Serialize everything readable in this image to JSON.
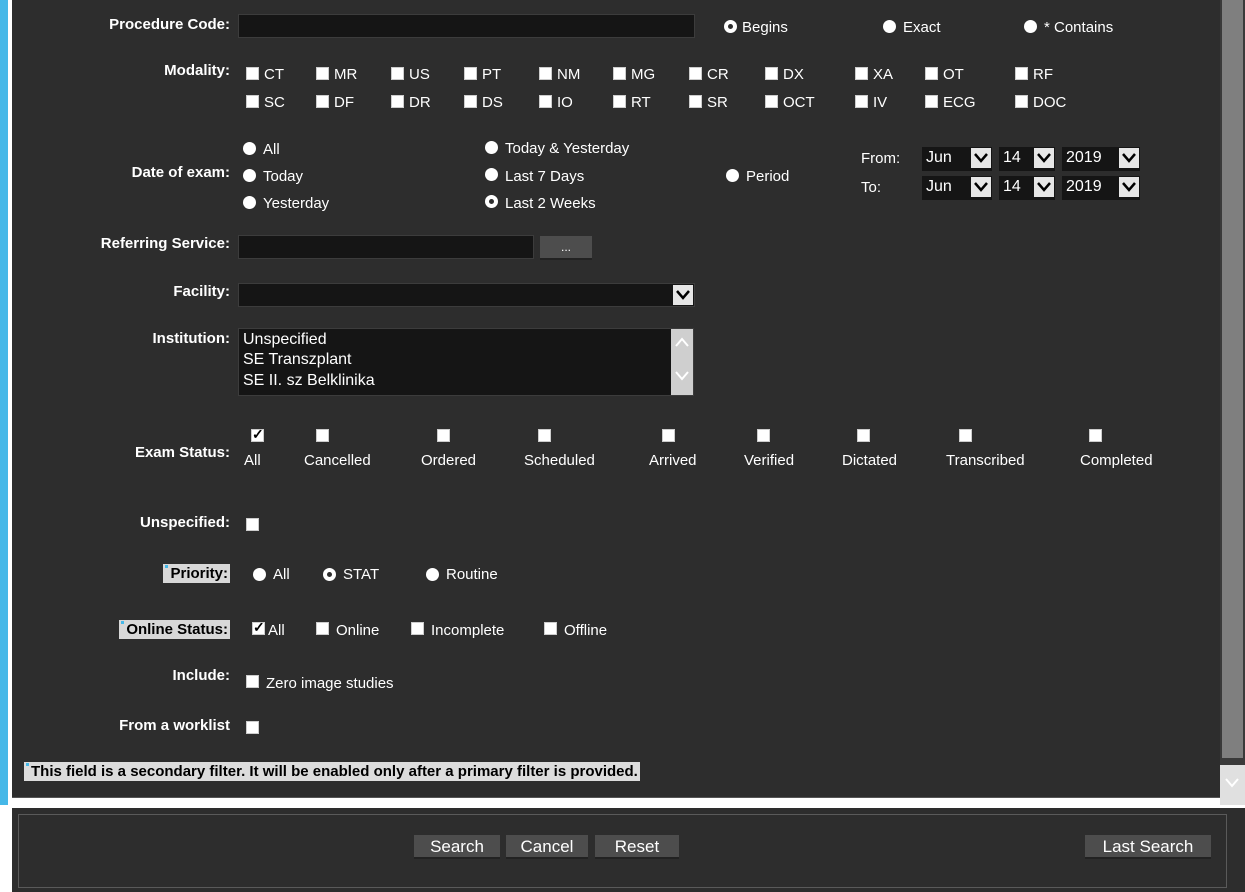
{
  "procedure_code": {
    "label": "Procedure Code:",
    "value": "",
    "match_options": [
      {
        "label": "Begins",
        "selected": true
      },
      {
        "label": "Exact",
        "selected": false
      },
      {
        "label": "* Contains",
        "selected": false
      }
    ]
  },
  "modality": {
    "label": "Modality:",
    "row1": [
      "CT",
      "MR",
      "US",
      "PT",
      "NM",
      "MG",
      "CR",
      "DX",
      "XA",
      "OT",
      "RF"
    ],
    "row2": [
      "SC",
      "DF",
      "DR",
      "DS",
      "IO",
      "RT",
      "SR",
      "OCT",
      "IV",
      "ECG",
      "DOC"
    ]
  },
  "date_of_exam": {
    "label": "Date of exam:",
    "options": [
      {
        "label": "All",
        "selected": false
      },
      {
        "label": "Today",
        "selected": false
      },
      {
        "label": "Yesterday",
        "selected": false
      },
      {
        "label": "Today & Yesterday",
        "selected": false
      },
      {
        "label": "Last 7 Days",
        "selected": false
      },
      {
        "label": "Last 2 Weeks",
        "selected": true
      },
      {
        "label": "Period",
        "selected": false
      }
    ],
    "from_label": "From:",
    "to_label": "To:",
    "from": {
      "month": "Jun",
      "day": "14",
      "year": "2019"
    },
    "to": {
      "month": "Jun",
      "day": "14",
      "year": "2019"
    }
  },
  "referring_service": {
    "label": "Referring Service:",
    "value": "",
    "browse_label": "..."
  },
  "facility": {
    "label": "Facility:",
    "value": ""
  },
  "institution": {
    "label": "Institution:",
    "items": [
      "Unspecified",
      "SE Transzplant",
      "SE II. sz Belklinika"
    ]
  },
  "exam_status": {
    "label": "Exam Status:",
    "options": [
      {
        "label": "All",
        "checked": true
      },
      {
        "label": "Cancelled",
        "checked": false
      },
      {
        "label": "Ordered",
        "checked": false
      },
      {
        "label": "Scheduled",
        "checked": false
      },
      {
        "label": "Arrived",
        "checked": false
      },
      {
        "label": "Verified",
        "checked": false
      },
      {
        "label": "Dictated",
        "checked": false
      },
      {
        "label": "Transcribed",
        "checked": false
      },
      {
        "label": "Completed",
        "checked": false
      }
    ]
  },
  "unspecified": {
    "label": "Unspecified:",
    "checked": false
  },
  "priority": {
    "label": "Priority:",
    "options": [
      {
        "label": "All",
        "selected": false
      },
      {
        "label": "STAT",
        "selected": true
      },
      {
        "label": "Routine",
        "selected": false
      }
    ]
  },
  "online_status": {
    "label": "Online Status:",
    "options": [
      {
        "label": "All",
        "checked": true
      },
      {
        "label": "Online",
        "checked": false
      },
      {
        "label": "Incomplete",
        "checked": false
      },
      {
        "label": "Offline",
        "checked": false
      }
    ]
  },
  "include": {
    "label": "Include:",
    "option": "Zero image studies",
    "checked": false
  },
  "worklist": {
    "label": "From a worklist",
    "checked": false
  },
  "note": "This field is a secondary filter. It will be enabled only after a primary filter is provided.",
  "buttons": {
    "search": "Search",
    "cancel": "Cancel",
    "reset": "Reset",
    "last_search": "Last Search"
  },
  "colors": {
    "panel": "#2d2d2d",
    "accent": "#45b8e8",
    "input": "#151515"
  }
}
